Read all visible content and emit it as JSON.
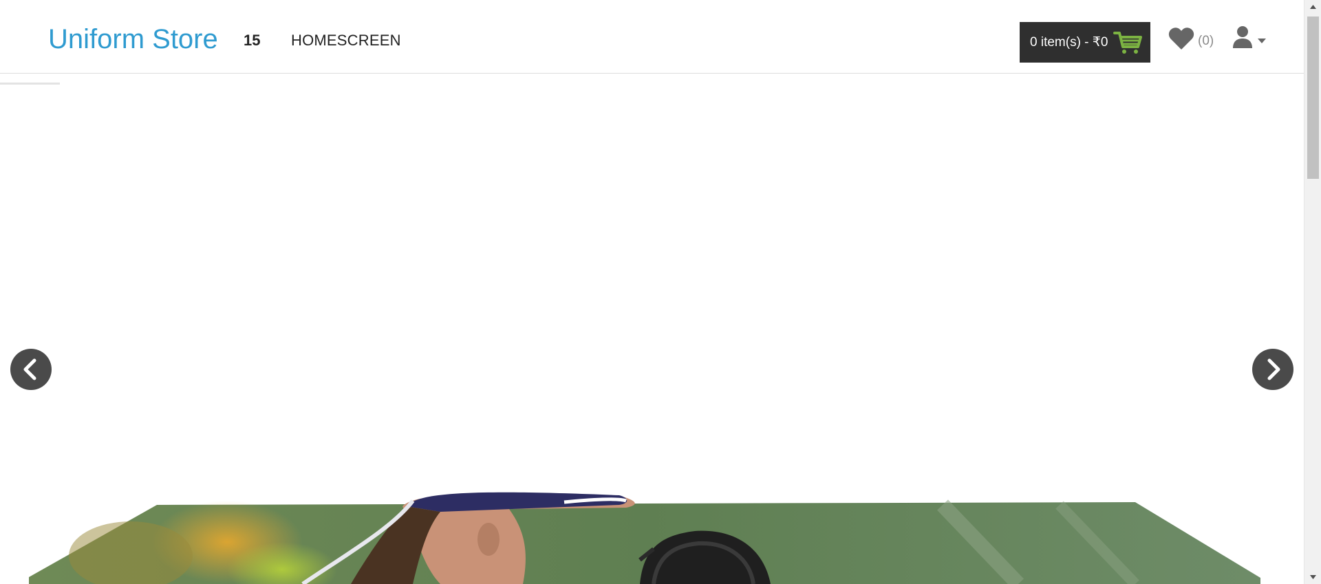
{
  "header": {
    "logo_text": "Uniform Store",
    "nav": [
      {
        "label": "15"
      },
      {
        "label": "HOMESCREEN"
      }
    ],
    "cart": {
      "label": "0 item(s) - ₹0",
      "icon": "cart-icon",
      "icon_color": "#7cb342"
    },
    "wishlist": {
      "icon": "heart-icon",
      "count_label": "(0)"
    },
    "account": {
      "icon": "user-icon",
      "dropdown_icon": "caret-down-icon"
    }
  },
  "carousel": {
    "prev_icon": "chevron-left-icon",
    "next_icon": "chevron-right-icon",
    "slide_image": "softball-player-photo"
  },
  "colors": {
    "brand": "#2f9bd0",
    "cart_bg": "#2f2f2f",
    "arrow_bg": "#4a4a4a",
    "icon_gray": "#666666"
  }
}
